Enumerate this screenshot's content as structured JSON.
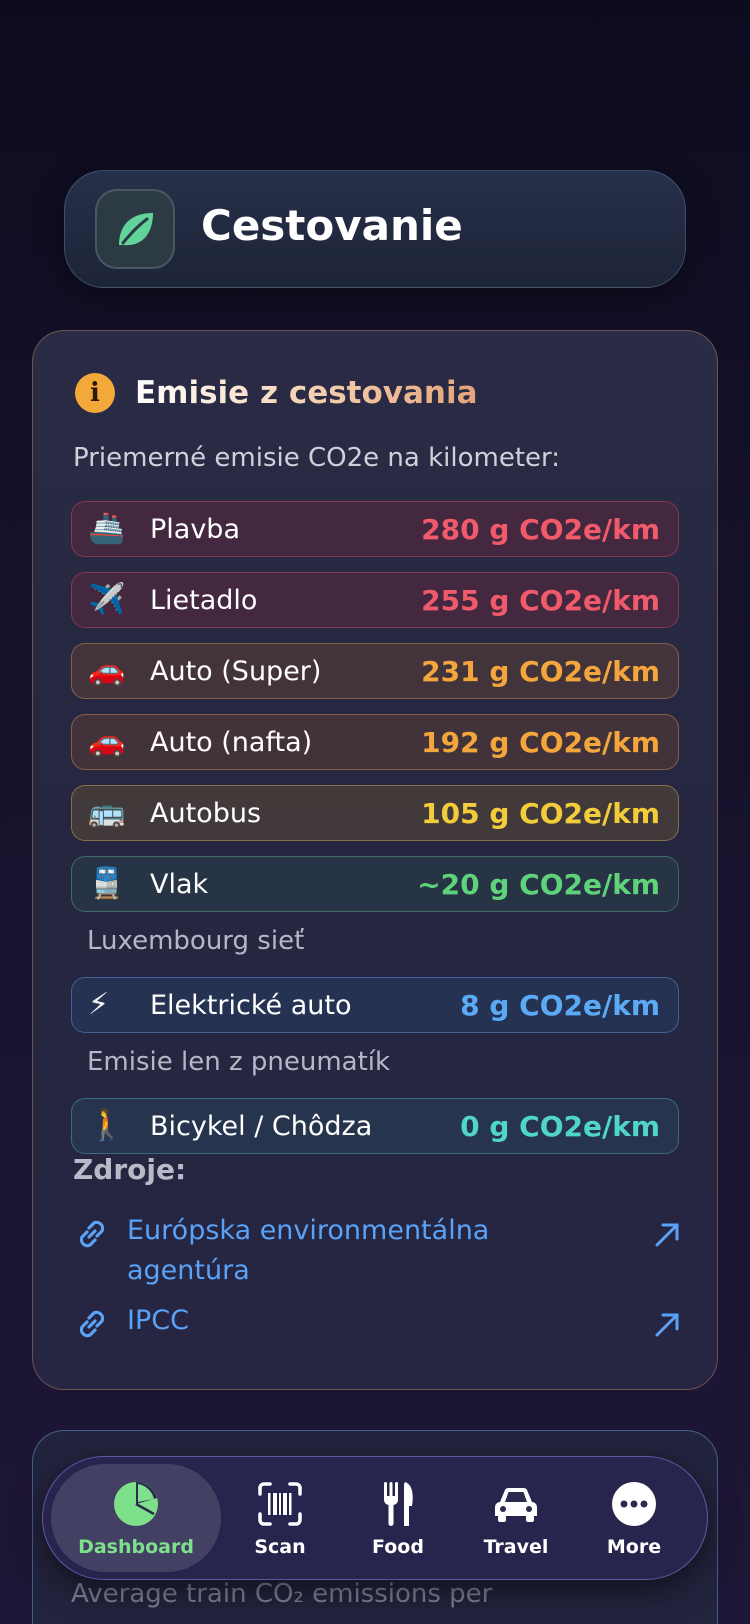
{
  "header": {
    "title": "Cestovanie",
    "icon": "leaf-icon"
  },
  "info_card": {
    "title": "Emisie z cestovania",
    "subtitle": "Priemerné emisie CO2e na kilometer:",
    "rows": [
      {
        "emoji": "🚢",
        "label": "Plavba",
        "value": "280 g CO2e/km",
        "color": "#f05a6a",
        "style": "red"
      },
      {
        "emoji": "✈️",
        "label": "Lietadlo",
        "value": "255 g CO2e/km",
        "color": "#f05a6a",
        "style": "red"
      },
      {
        "emoji": "🚗",
        "label": "Auto (Super)",
        "value": "231 g CO2e/km",
        "color": "#f4a63c",
        "style": "orange"
      },
      {
        "emoji": "🚗",
        "label": "Auto (nafta)",
        "value": "192 g CO2e/km",
        "color": "#f4a63c",
        "style": "orange"
      },
      {
        "emoji": "🚌",
        "label": "Autobus",
        "value": "105 g CO2e/km",
        "color": "#f2cc3a",
        "style": "yellow"
      },
      {
        "emoji": "🚆",
        "label": "Vlak",
        "value": "~20 g CO2e/km",
        "color": "#5fd37a",
        "style": "green",
        "note": "Luxembourg sieť"
      },
      {
        "emoji": "⚡",
        "label": "Elektrické auto",
        "value": "8 g CO2e/km",
        "color": "#5aaaf5",
        "style": "blue",
        "note": "Emisie len z pneumatík"
      },
      {
        "emoji": "🚶",
        "label": "Bicykel / Chôdza",
        "value": "0 g CO2e/km",
        "color": "#4fd6c8",
        "style": "teal"
      }
    ],
    "sources_title": "Zdroje:",
    "sources": [
      {
        "line1": "Európska environmentálna",
        "line2": "agentúra"
      },
      {
        "line1": "IPCC",
        "line2": ""
      }
    ]
  },
  "next_card": {
    "ghost_text": "Average train CO₂ emissions per"
  },
  "tabbar": {
    "tabs": [
      {
        "label": "Dashboard",
        "icon": "pie-chart-icon",
        "active": true
      },
      {
        "label": "Scan",
        "icon": "barcode-scan-icon",
        "active": false
      },
      {
        "label": "Food",
        "icon": "fork-knife-icon",
        "active": false
      },
      {
        "label": "Travel",
        "icon": "car-icon",
        "active": false
      },
      {
        "label": "More",
        "icon": "more-dots-icon",
        "active": false
      }
    ]
  },
  "colors": {
    "accent_green": "#7ee08a",
    "link_blue": "#5aa2f5",
    "info_orange": "#f2a93a"
  }
}
